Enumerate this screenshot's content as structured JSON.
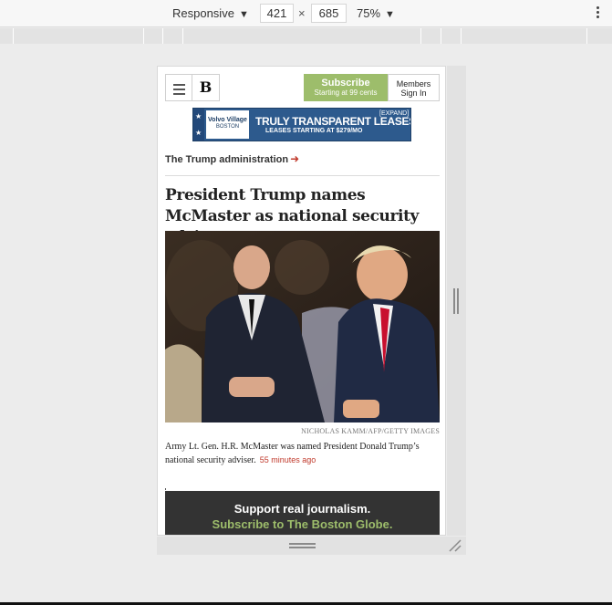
{
  "devtools": {
    "device_mode": "Responsive",
    "width": "421",
    "height": "685",
    "times": "×",
    "zoom": "75%"
  },
  "header": {
    "logo": "B",
    "subscribe_label": "Subscribe",
    "subscribe_sub": "Starting at 99 cents",
    "members_label": "Members",
    "sign_in_label": "Sign In"
  },
  "ad": {
    "brand_line1": "Volvo Village",
    "brand_line2": "BOSTON",
    "headline": "TRULY TRANSPARENT LEASES",
    "subline": "LEASES STARTING AT $279/MO",
    "expand": "[EXPAND]"
  },
  "topic": {
    "label": "The Trump administration",
    "arrow": "➜"
  },
  "article": {
    "headline": "President Trump names McMaster as national security adviser",
    "photo_credit": "NICHOLAS KAMM/AFP/GETTY IMAGES",
    "caption": "Army Lt. Gen. H.R. McMaster was named President Donald Trump’s national security adviser.",
    "timestamp": "55 minutes ago"
  },
  "promo": {
    "line1": "Support real journalism.",
    "line2": "Subscribe to The Boston Globe."
  },
  "colors": {
    "subscribe_green": "#9dbd6b",
    "accent_red": "#c0392b",
    "ad_blue": "#2d5a8d"
  }
}
